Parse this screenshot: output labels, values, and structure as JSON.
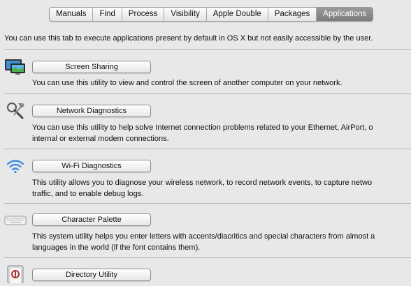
{
  "tabs": [
    "Manuals",
    "Find",
    "Process",
    "Visibility",
    "Apple Double",
    "Packages",
    "Applications"
  ],
  "active_tab": "Applications",
  "intro": "You can use this tab to execute applications present by default in OS X but not easily accessible by the user.",
  "apps": [
    {
      "icon": "screen-sharing-icon",
      "button": "Screen Sharing",
      "desc": [
        "You can use this utility to view and control the screen of another computer on your network."
      ]
    },
    {
      "icon": "network-diagnostics-icon",
      "button": "Network Diagnostics",
      "desc": [
        "You can use this utility to help solve Internet connection problems related to your Ethernet, AirPort, o",
        "internal or external modem connections."
      ]
    },
    {
      "icon": "wifi-icon",
      "button": "Wi-Fi Diagnostics",
      "desc": [
        "This utility allows you to diagnose your wireless network, to record network events, to capture netwo",
        "traffic, and to enable debug logs."
      ]
    },
    {
      "icon": "keyboard-icon",
      "button": "Character Palette",
      "desc": [
        "This system utility helps you enter letters with accents/diacritics and special characters from almost a",
        "languages in the world (if the font contains them)."
      ]
    },
    {
      "icon": "directory-utility-icon",
      "button": "Directory Utility",
      "desc": []
    }
  ]
}
